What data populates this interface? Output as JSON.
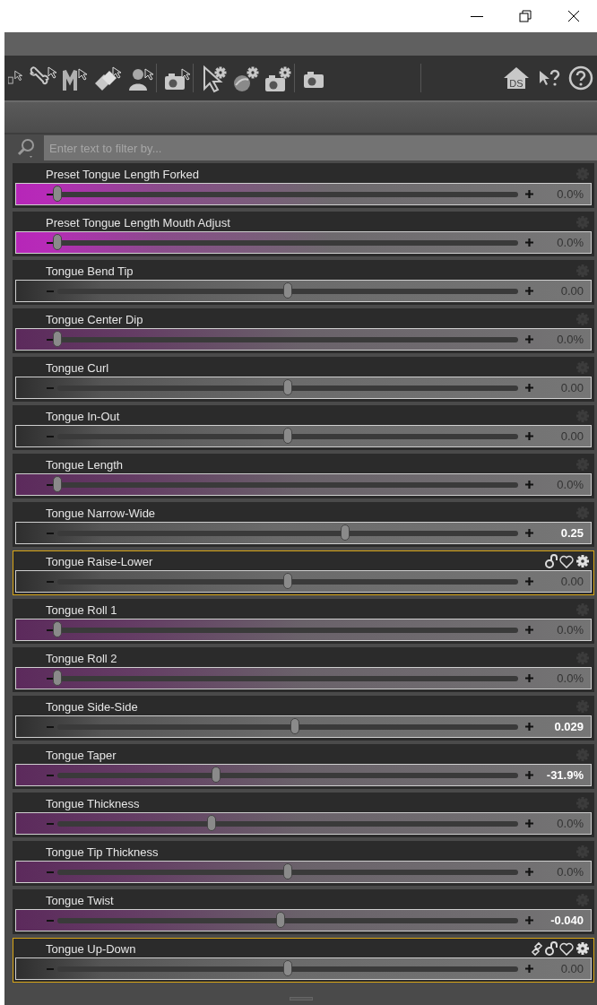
{
  "toolbar": {
    "home_label": "DS"
  },
  "filter": {
    "placeholder": "Enter text to filter by..."
  },
  "sliders": [
    {
      "label": "Preset Tongue Length Forked",
      "value": "0.0%",
      "level": 0,
      "kind": "preset",
      "changed": false,
      "selected": false
    },
    {
      "label": "Preset Tongue Length Mouth Adjust",
      "value": "0.0%",
      "level": 0,
      "kind": "preset",
      "changed": false,
      "selected": false
    },
    {
      "label": "Tongue Bend Tip",
      "value": "0.00",
      "level": 0.5,
      "kind": "bone",
      "changed": false,
      "selected": false
    },
    {
      "label": "Tongue Center Dip",
      "value": "0.0%",
      "level": 0,
      "kind": "morph",
      "changed": false,
      "selected": false
    },
    {
      "label": "Tongue Curl",
      "value": "0.00",
      "level": 0.5,
      "kind": "bone",
      "changed": false,
      "selected": false
    },
    {
      "label": "Tongue In-Out",
      "value": "0.00",
      "level": 0.5,
      "kind": "bone",
      "changed": false,
      "selected": false
    },
    {
      "label": "Tongue Length",
      "value": "0.0%",
      "level": 0,
      "kind": "morph",
      "changed": false,
      "selected": false
    },
    {
      "label": "Tongue Narrow-Wide",
      "value": "0.25",
      "level": 0.625,
      "kind": "bone",
      "changed": true,
      "selected": false
    },
    {
      "label": "Tongue Raise-Lower",
      "value": "0.00",
      "level": 0.5,
      "kind": "bone",
      "changed": false,
      "selected": true,
      "linked": false,
      "locked": true,
      "favorite": true
    },
    {
      "label": "Tongue Roll 1",
      "value": "0.0%",
      "level": 0,
      "kind": "morph",
      "changed": false,
      "selected": false
    },
    {
      "label": "Tongue Roll 2",
      "value": "0.0%",
      "level": 0,
      "kind": "morph",
      "changed": false,
      "selected": false
    },
    {
      "label": "Tongue Side-Side",
      "value": "0.029",
      "level": 0.515,
      "kind": "bone",
      "changed": true,
      "selected": false
    },
    {
      "label": "Tongue Taper",
      "value": "-31.9%",
      "level": 0.345,
      "kind": "morph",
      "changed": true,
      "selected": false
    },
    {
      "label": "Tongue Thickness",
      "value": "0.0%",
      "level": 0.335,
      "kind": "morph",
      "changed": false,
      "selected": false
    },
    {
      "label": "Tongue Tip Thickness",
      "value": "0.0%",
      "level": 0.5,
      "kind": "morph",
      "changed": false,
      "selected": false
    },
    {
      "label": "Tongue Twist",
      "value": "-0.040",
      "level": 0.485,
      "kind": "morph",
      "changed": true,
      "selected": false
    },
    {
      "label": "Tongue Up-Down",
      "value": "0.00",
      "level": 0.5,
      "kind": "bone",
      "changed": false,
      "selected": true,
      "linked": true,
      "locked": true,
      "favorite": true
    }
  ]
}
